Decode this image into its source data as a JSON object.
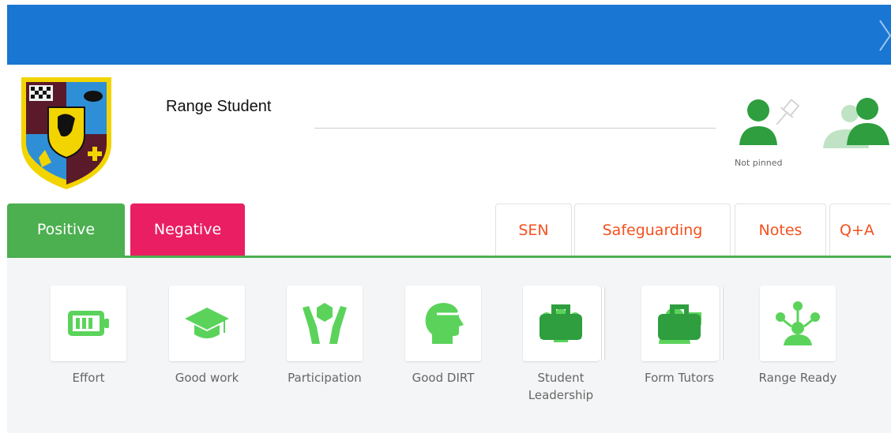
{
  "header": {
    "close_icon": "chevron-right-icon",
    "accent": "#1976d2"
  },
  "student": {
    "name": "Range Student"
  },
  "pin": {
    "status": "Not pinned",
    "icon": "pin-icon"
  },
  "tabs": {
    "positive": "Positive",
    "negative": "Negative",
    "sen": "SEN",
    "safeguarding": "Safeguarding",
    "notes": "Notes",
    "qa": "Q+A"
  },
  "colors": {
    "positive": "#4caf50",
    "negative": "#e91e63",
    "tab_text": "#f4511e"
  },
  "behaviours": [
    {
      "label": "Effort",
      "icon": "battery-icon"
    },
    {
      "label": "Good work",
      "icon": "graduation-cap-icon"
    },
    {
      "label": "Participation",
      "icon": "hands-cube-icon"
    },
    {
      "label": "Good DIRT",
      "icon": "head-icon"
    },
    {
      "label": "Student Leadership",
      "icon": "people-group-icon"
    },
    {
      "label": "Form Tutors",
      "icon": "person-speaking-icon"
    },
    {
      "label": "Range Ready",
      "icon": "network-person-icon"
    }
  ]
}
